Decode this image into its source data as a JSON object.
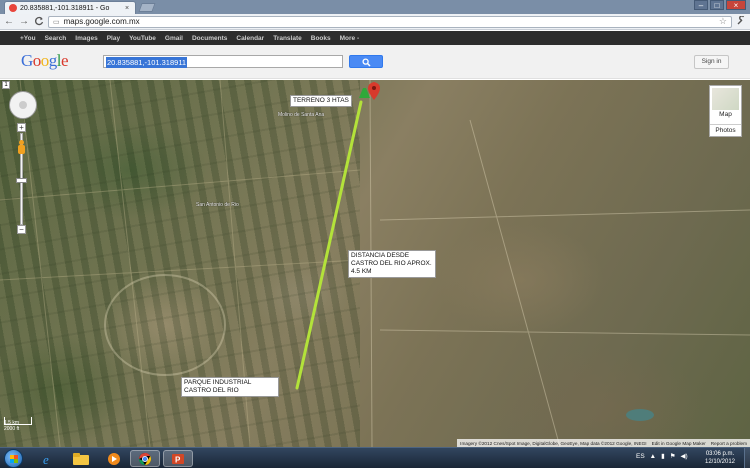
{
  "browser": {
    "tab_title": "20.835881,-101.318911 - Go",
    "tab_close": "×",
    "url": "maps.google.com.mx",
    "window_buttons": [
      "–",
      "□",
      "×"
    ],
    "nav": {
      "back": "←",
      "forward": "→",
      "reload": "C"
    }
  },
  "gbar": {
    "links": [
      "+You",
      "Search",
      "Images",
      "Play",
      "YouTube",
      "Gmail",
      "Documents",
      "Calendar",
      "Translate",
      "Books",
      "More -"
    ]
  },
  "header": {
    "logo": [
      "G",
      "o",
      "o",
      "g",
      "l",
      "e"
    ],
    "search_value": "20.835881,-101.318911",
    "search_button_icon": "magnifier-icon",
    "sign_in": "Sign in"
  },
  "map": {
    "labels": {
      "terreno": "TERRENO 3 HTAS",
      "distancia": "DISTANCIA DESDE CASTRO DEL RIO APROX. 4.5 KM",
      "parque": "PARQUE INDUSTRIAL CASTRO DEL RIO"
    },
    "towns": [
      "Molino de Santa Ana",
      "San Antonio de Rio"
    ],
    "map_type": {
      "map": "Map",
      "photos": "Photos"
    },
    "zoom": {
      "plus": "+",
      "minus": "−"
    },
    "scale": [
      "1.5 km",
      "2000 ft"
    ],
    "copyright": "Imagery ©2012 Cnes/Spot Image, DigitalGlobe, GeoEye, Map data ©2012 Google, INEGI",
    "edit_link": "Edit in Google Map Maker",
    "report_link": "Report a problem",
    "corner_marker": "1"
  },
  "taskbar": {
    "lang": "ES",
    "time": "03:06 p.m.",
    "date": "12/10/2012",
    "apps": [
      "ie-icon",
      "explorer-icon",
      "media-player-icon",
      "chrome-icon",
      "powerpoint-icon"
    ]
  },
  "colors": {
    "route_line": "#b3e23a",
    "start_pin": "#2fa83a",
    "end_pin": "#d83a2c",
    "search_button": "#4a8af4"
  }
}
